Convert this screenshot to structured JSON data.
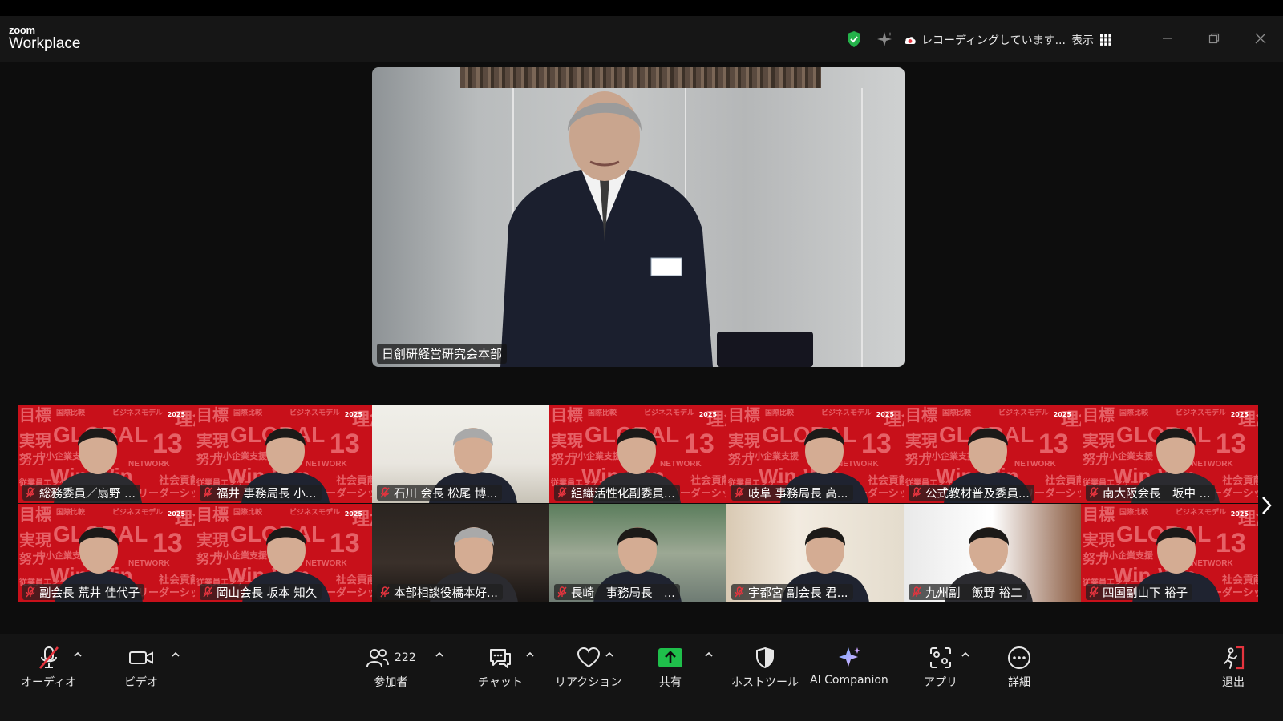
{
  "app": {
    "brand_top": "zoom",
    "brand_bottom": "Workplace"
  },
  "titlebar": {
    "recording_text": "レコーディングしています...",
    "view_label": "表示"
  },
  "speaker": {
    "name": "日創研経営研究会本部"
  },
  "gallery": [
    {
      "name": "総務委員／扇野 ...",
      "bg": "branded",
      "year": "2025"
    },
    {
      "name": "福井 事務局長 小...",
      "bg": "branded",
      "year": "2025"
    },
    {
      "name": "石川 会長 松尾 博...",
      "bg": "camera"
    },
    {
      "name": "組織活性化副委員...",
      "bg": "branded",
      "year": "2025"
    },
    {
      "name": "岐阜 事務局長 高...",
      "bg": "branded",
      "year": "2025"
    },
    {
      "name": "公式教材普及委員...",
      "bg": "branded",
      "year": "2025"
    },
    {
      "name": "南大阪会長　坂中 ...",
      "bg": "branded",
      "year": "2025"
    },
    {
      "name": "副会長 荒井 佳代子",
      "bg": "branded",
      "year": "2025"
    },
    {
      "name": "岡山会長 坂本 知久",
      "bg": "branded",
      "year": "2025"
    },
    {
      "name": "本部相談役橋本好...",
      "bg": "camera"
    },
    {
      "name": "長崎　事務局長　...",
      "bg": "camera"
    },
    {
      "name": "宇都宮 副会長 君...",
      "bg": "camera"
    },
    {
      "name": "九州副　飯野 裕二",
      "bg": "camera"
    },
    {
      "name": "四国副山下 裕子",
      "bg": "branded",
      "year": "2025"
    }
  ],
  "branded_bg_words": [
    "目標",
    "国際比較",
    "ビジネスモデル",
    "実現",
    "GLOBAL",
    "努力",
    "中小企業支援",
    "Win-Win",
    "13",
    "理念",
    "従業員エンゲージメント",
    "NETWORK",
    "社会貢献",
    "リーダーシップ"
  ],
  "toolbar": {
    "audio": "オーディオ",
    "video": "ビデオ",
    "participants": "参加者",
    "participants_count": "222",
    "chat": "チャット",
    "reactions": "リアクション",
    "share": "共有",
    "host_tools": "ホストツール",
    "ai_companion": "AI Companion",
    "apps": "アプリ",
    "more": "詳細",
    "leave": "退出"
  },
  "colors": {
    "share_green": "#1fbf4b",
    "leave_red": "#e5343e",
    "tile_red": "#c8101a",
    "shield_green": "#24b24a"
  }
}
